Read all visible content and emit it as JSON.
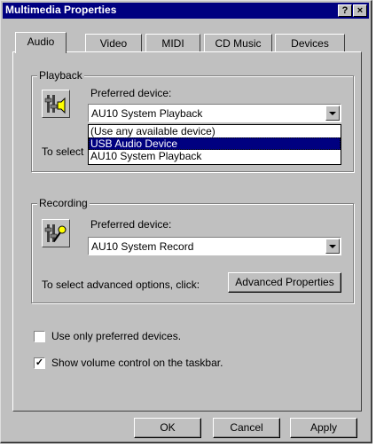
{
  "window": {
    "title": "Multimedia Properties",
    "help_label": "?",
    "close_label": "×"
  },
  "tabs": [
    {
      "label": "Audio",
      "active": true
    },
    {
      "label": "Video"
    },
    {
      "label": "MIDI"
    },
    {
      "label": "CD Music"
    },
    {
      "label": "Devices"
    }
  ],
  "playback": {
    "legend": "Playback",
    "device_label": "Preferred device:",
    "selected": "AU10 System Playback",
    "options": [
      "(Use any available device)",
      "USB Audio Device",
      "AU10 System Playback"
    ],
    "hidden_text": "To select"
  },
  "recording": {
    "legend": "Recording",
    "device_label": "Preferred device:",
    "selected": "AU10 System Record",
    "advanced_text": "To select advanced options, click:",
    "advanced_button": "Advanced Properties"
  },
  "options": {
    "use_preferred_label": "Use only preferred devices.",
    "use_preferred_checked": false,
    "show_volume_label": "Show volume control on the taskbar.",
    "show_volume_checked": true
  },
  "buttons": {
    "ok": "OK",
    "cancel": "Cancel",
    "apply": "Apply"
  },
  "colors": {
    "titlebar": "#000080",
    "face": "#c0c0c0",
    "highlight": "#000080"
  }
}
